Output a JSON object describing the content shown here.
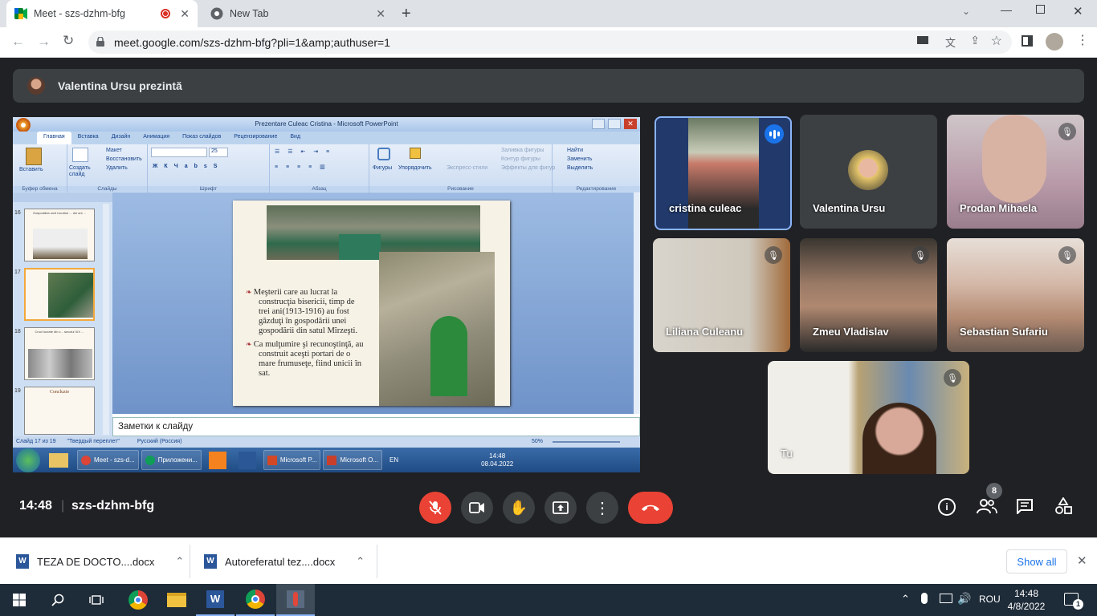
{
  "browser": {
    "tabs": [
      {
        "title": "Meet - szs-dzhm-bfg",
        "active": true
      },
      {
        "title": "New Tab",
        "active": false
      }
    ],
    "url": "meet.google.com/szs-dzhm-bfg?pli=1&amp;authuser=1"
  },
  "meet": {
    "presenter_banner": "Valentina Ursu prezintă",
    "time": "14:48",
    "meeting_code": "szs-dzhm-bfg",
    "participant_count": "8",
    "participants": [
      {
        "name": "cristina culeac",
        "speaking": true
      },
      {
        "name": "Valentina Ursu",
        "muted": false
      },
      {
        "name": "Prodan Mihaela",
        "muted": true
      },
      {
        "name": "Liliana Culeanu",
        "muted": true
      },
      {
        "name": "Zmeu Vladislav",
        "muted": true
      },
      {
        "name": "Sebastian Sufariu",
        "muted": true
      },
      {
        "name": "Tu",
        "muted": true
      }
    ]
  },
  "shared_screen": {
    "window_title": "Prezentare Culeac Cristina - Microsoft PowerPoint",
    "ribbon_tabs": [
      "Главная",
      "Вставка",
      "Дизайн",
      "Анимация",
      "Показ слайдов",
      "Рецензирование",
      "Вид"
    ],
    "ribbon_groups": [
      "Буфер обмена",
      "Слайды",
      "Шрифт",
      "Абзац",
      "Рисование",
      "Редактирование"
    ],
    "ribbon_buttons": {
      "paste": "Вставить",
      "new_slide": "Создать слайд",
      "layout": "Макет",
      "reset": "Восстановить",
      "delete": "Удалить",
      "shapes": "Фигуры",
      "arrange": "Упорядочить",
      "quick_styles": "Экспресс-стили",
      "shape_fill": "Заливка фигуры",
      "shape_outline": "Контур фигуры",
      "shape_effects": "Эффекты для фигур",
      "find": "Найти",
      "replace": "Заменить",
      "select": "Выделить",
      "font_size": "25"
    },
    "thumbnails": [
      {
        "num": "16",
        "title": "Gospodăria unei locuitori ... doi ani ..."
      },
      {
        "num": "17",
        "title": ""
      },
      {
        "num": "18",
        "title": "Cruci lucrate din c... secolul XIX ..."
      },
      {
        "num": "19",
        "title": "Concluzie"
      }
    ],
    "slide_bullets": [
      "Meşterii care au lucrat la construcţia bisericii, timp de trei ani(1913-1916) au fost găzduţi în gospodării unei gospodării din satul Mîrzeşti.",
      "Ca mulţumire şi recunoştinţă, au construit aceşti portari de o mare frumuseţe, fiind unicii în sat."
    ],
    "notes_placeholder": "Заметки к слайду",
    "status_slide": "Слайд 17 из 19",
    "status_theme": "\"Твердый переплет\"",
    "status_lang": "Русский (Россия)",
    "zoom": "50%",
    "taskbar_items": [
      "Meet - szs-d...",
      "Приложени...",
      "Microsoft P...",
      "Microsoft O..."
    ],
    "taskbar_lang": "EN",
    "taskbar_time": "14:48",
    "taskbar_date": "08.04.2022"
  },
  "downloads": {
    "items": [
      "TEZA DE DOCTO....docx",
      "Autoreferatul tez....docx"
    ],
    "show_all": "Show all"
  },
  "win_taskbar": {
    "lang": "ROU",
    "time": "14:48",
    "date": "4/8/2022",
    "notifications": "1"
  },
  "colors": {
    "meet_bg": "#202124",
    "end_call": "#ea4335",
    "speaking": "#8ab4f8"
  }
}
